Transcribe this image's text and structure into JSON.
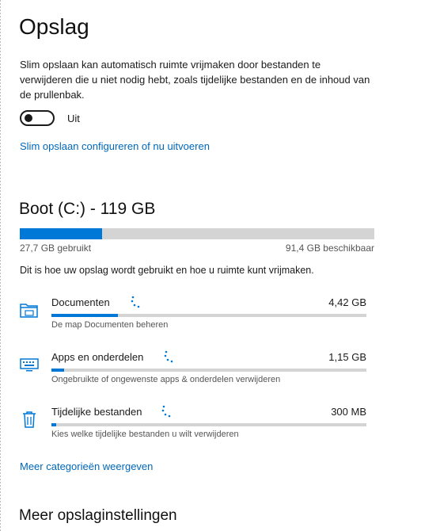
{
  "page": {
    "title": "Opslag",
    "description": "Slim opslaan kan automatisch ruimte vrijmaken door bestanden te verwijderen die u niet nodig hebt, zoals tijdelijke bestanden en de inhoud van de prullenbak.",
    "toggle": {
      "state_label": "Uit",
      "on": false
    },
    "configure_link": "Slim opslaan configureren of nu uitvoeren"
  },
  "drive": {
    "title": "Boot (C:) - 119 GB",
    "used_label": "27,7 GB gebruikt",
    "free_label": "91,4 GB beschikbaar",
    "used_fraction": 0.233,
    "intro": "Dit is hoe uw opslag wordt gebruikt en hoe u ruimte kunt vrijmaken."
  },
  "categories": [
    {
      "name": "Documenten",
      "size": "4,42 GB",
      "subtitle": "De map Documenten beheren",
      "icon": "folder-icon",
      "fraction": 0.21
    },
    {
      "name": "Apps en onderdelen",
      "size": "1,15 GB",
      "subtitle": "Ongebruikte of ongewenste apps & onderdelen verwijderen",
      "icon": "keyboard-icon",
      "fraction": 0.04
    },
    {
      "name": "Tijdelijke bestanden",
      "size": "300 MB",
      "subtitle": "Kies welke tijdelijke bestanden u wilt verwijderen",
      "icon": "trash-icon",
      "fraction": 0.015
    }
  ],
  "more_categories_link": "Meer categorieën weergeven",
  "more_settings_title": "Meer opslaginstellingen",
  "colors": {
    "accent": "#0078d7",
    "link": "#0067b8",
    "track": "#d4d4d4"
  }
}
